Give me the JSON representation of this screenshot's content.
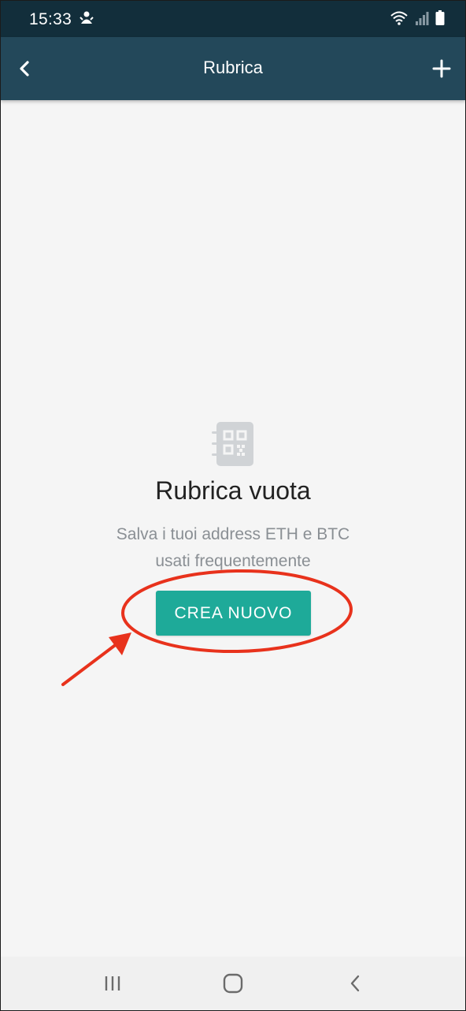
{
  "status_bar": {
    "time": "15:33",
    "left_icon": "notification-icon",
    "right_icons": [
      "wifi-icon",
      "signal-icon",
      "battery-icon"
    ]
  },
  "app_bar": {
    "title": "Rubrica",
    "back_icon": "chevron-left-icon",
    "add_icon": "plus-icon"
  },
  "empty_state": {
    "icon": "address-book-qr-icon",
    "title": "Rubrica vuota",
    "subtitle_line1": "Salva i tuoi address ETH e BTC",
    "subtitle_line2": "usati frequentemente",
    "button_label": "CREA NUOVO"
  },
  "nav_bar": {
    "recents_icon": "recents-icon",
    "home_icon": "home-icon",
    "back_icon": "back-icon"
  },
  "colors": {
    "status_bar": "#122e3b",
    "app_bar": "#23485a",
    "accent": "#1eaa99",
    "annotation": "#e8321c",
    "background": "#f5f5f5"
  }
}
